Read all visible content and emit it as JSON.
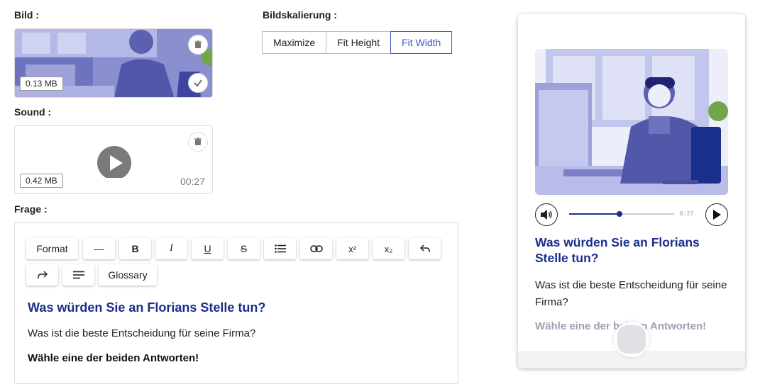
{
  "image_section": {
    "label": "Bild :",
    "size": "0.13 MB"
  },
  "scaling": {
    "label": "Bildskalierung :",
    "options": [
      "Maximize",
      "Fit Height",
      "Fit Width"
    ],
    "selected": "Fit Width"
  },
  "sound_section": {
    "label": "Sound :",
    "size": "0.42 MB",
    "duration": "00:27"
  },
  "question_section": {
    "label": "Frage :"
  },
  "toolbar": {
    "format": "Format",
    "hr": "—",
    "bold": "B",
    "italic": "I",
    "underline": "U",
    "strike": "S",
    "superscript": "x²",
    "subscript": "x₂",
    "glossary": "Glossary"
  },
  "editor": {
    "title": "Was würden Sie an Florians Stelle tun?",
    "text": "Was ist die beste Entscheidung für seine Firma?",
    "instruction": "Wähle eine der beiden Antworten!"
  },
  "preview": {
    "time": "0:27",
    "progress": 0.48,
    "title": "Was würden Sie an Florians Stelle tun?",
    "text": "Was ist die beste Entscheidung für seine Firma?",
    "instruction": "Wähle eine der beiden Antworten!"
  },
  "colors": {
    "accent": "#3b5cc6",
    "title_blue": "#1a2e8c",
    "illustration": "#7b80c8"
  }
}
